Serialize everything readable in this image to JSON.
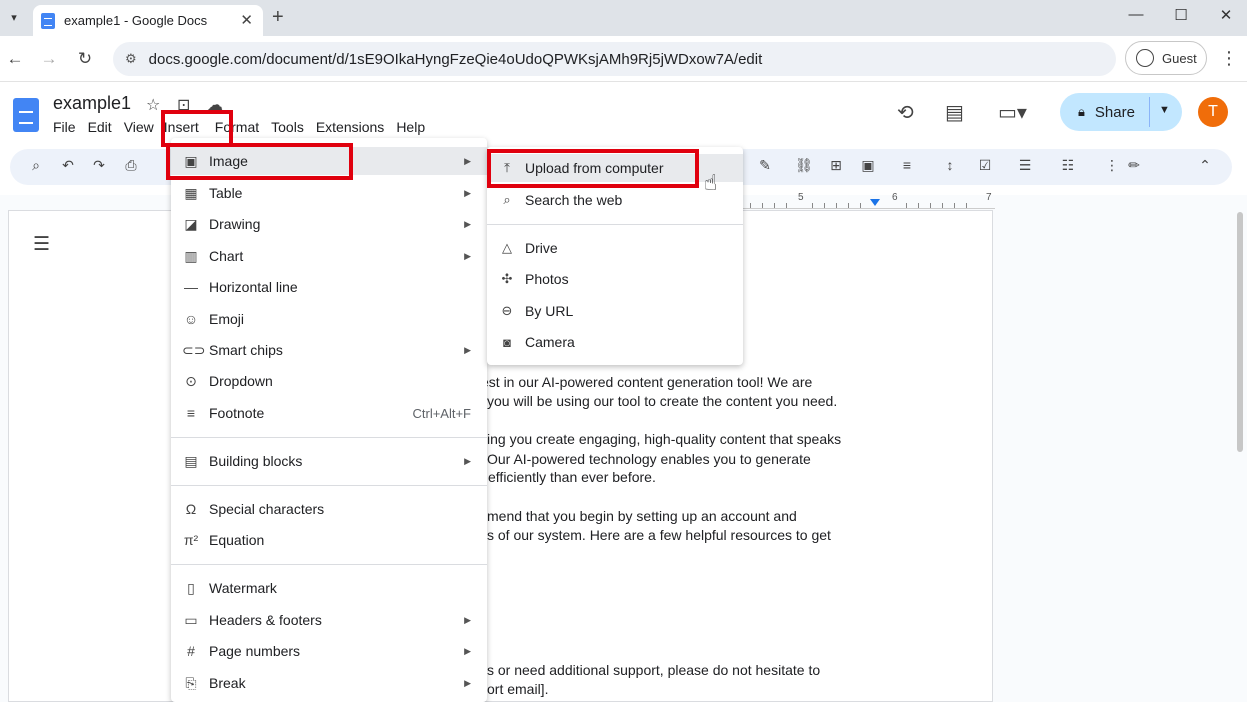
{
  "browser": {
    "tab_title": "example1 - Google Docs",
    "url": "docs.google.com/document/d/1sE9OIkaHyngFzeQie4oUdoQPWKsjAMh9Rj5jWDxow7A/edit",
    "profile": "Guest"
  },
  "doc": {
    "title": "example1",
    "menus": [
      "File",
      "Edit",
      "View",
      "Insert",
      "Format",
      "Tools",
      "Extensions",
      "Help"
    ],
    "share_label": "Share",
    "avatar_initial": "T"
  },
  "ruler": {
    "labels": [
      "5",
      "6",
      "7"
    ]
  },
  "insert_menu": {
    "items": [
      {
        "label": "Image",
        "icon": "image-icon",
        "submenu": true
      },
      {
        "label": "Table",
        "icon": "table-icon",
        "submenu": true
      },
      {
        "label": "Drawing",
        "icon": "drawing-icon",
        "submenu": true
      },
      {
        "label": "Chart",
        "icon": "chart-icon",
        "submenu": true
      },
      {
        "label": "Horizontal line",
        "icon": "horizontal-line-icon"
      },
      {
        "label": "Emoji",
        "icon": "emoji-icon"
      },
      {
        "label": "Smart chips",
        "icon": "smart-chips-icon",
        "submenu": true
      },
      {
        "label": "Dropdown",
        "icon": "dropdown-icon"
      },
      {
        "label": "Footnote",
        "icon": "footnote-icon",
        "shortcut": "Ctrl+Alt+F"
      },
      {
        "label": "Building blocks",
        "icon": "building-blocks-icon",
        "submenu": true
      },
      {
        "label": "Special characters",
        "icon": "omega-icon"
      },
      {
        "label": "Equation",
        "icon": "pi-icon"
      },
      {
        "label": "Watermark",
        "icon": "watermark-icon"
      },
      {
        "label": "Headers & footers",
        "icon": "headers-footers-icon",
        "submenu": true
      },
      {
        "label": "Page numbers",
        "icon": "hash-icon",
        "submenu": true
      },
      {
        "label": "Break",
        "icon": "break-icon",
        "submenu": true
      }
    ]
  },
  "image_submenu": {
    "items": [
      {
        "label": "Upload from computer",
        "icon": "upload-icon"
      },
      {
        "label": "Search the web",
        "icon": "search-icon"
      },
      {
        "label": "Drive",
        "icon": "drive-icon"
      },
      {
        "label": "Photos",
        "icon": "photos-icon"
      },
      {
        "label": "By URL",
        "icon": "link-icon"
      },
      {
        "label": "Camera",
        "icon": "camera-icon"
      }
    ]
  },
  "body_text": [
    "est in our AI-powered content generation tool! We are",
    "you will be using our tool to create the content you need.",
    "ing you create engaging, high-quality content that speaks",
    "Our AI-powered technology enables you to generate",
    "efficiently than ever before.",
    "mend that you begin by setting up an account and",
    "s of our system. Here are a few helpful resources to get",
    "s or need additional support, please do not hesitate to",
    "ort email]."
  ],
  "colors": {
    "accent": "#1a73e8",
    "share_bg": "#c2e7ff",
    "avatar": "#f06d0a",
    "highlight": "#e0000e"
  }
}
